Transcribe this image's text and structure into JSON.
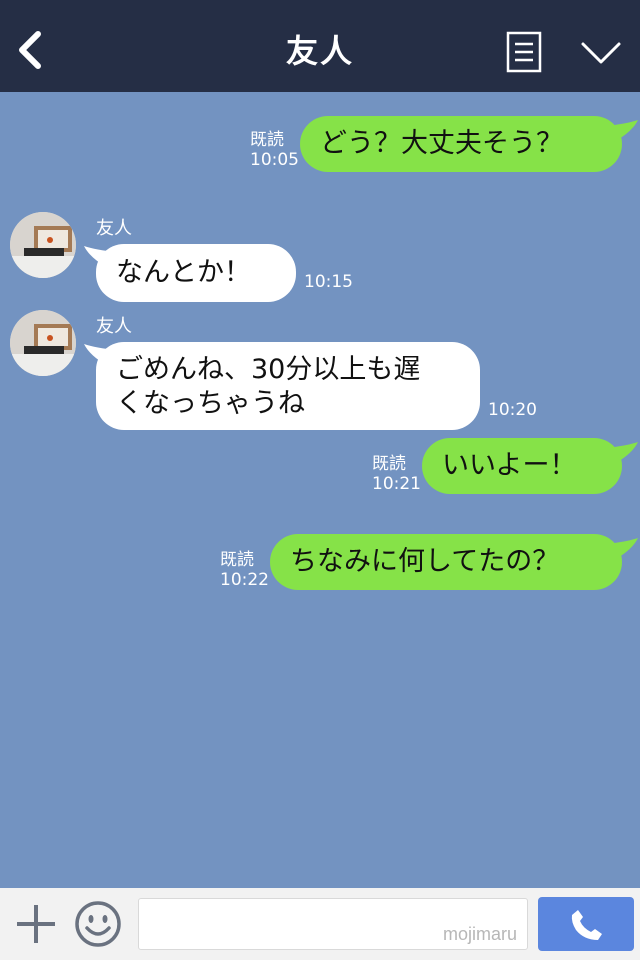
{
  "header": {
    "title": "友人",
    "back_icon": "chevron-left-icon",
    "menu_icon": "document-lines-icon",
    "expand_icon": "chevron-down-icon"
  },
  "colors": {
    "header_bg": "#252e45",
    "chat_bg": "#7393c1",
    "outgoing_bubble": "#86e248",
    "incoming_bubble": "#ffffff",
    "send_button": "#5b86de"
  },
  "messages": [
    {
      "direction": "out",
      "text": "どう？大丈夫そう？",
      "read_label": "既読",
      "time": "10:05"
    },
    {
      "direction": "in",
      "sender": "友人",
      "text": "なんとか！",
      "time": "10:15"
    },
    {
      "direction": "in",
      "sender": "友人",
      "text_lines": [
        "ごめんね、30分以上も遅",
        "くなっちゃうね"
      ],
      "time": "10:20"
    },
    {
      "direction": "out",
      "text": "いいよー！",
      "read_label": "既読",
      "time": "10:21"
    },
    {
      "direction": "out",
      "text": "ちなみに何してたの？",
      "read_label": "既読",
      "time": "10:22"
    }
  ],
  "footer": {
    "plus_icon": "plus-icon",
    "emoji_icon": "smiley-icon",
    "input_value": "",
    "watermark": "mojimaru",
    "call_icon": "phone-icon"
  }
}
